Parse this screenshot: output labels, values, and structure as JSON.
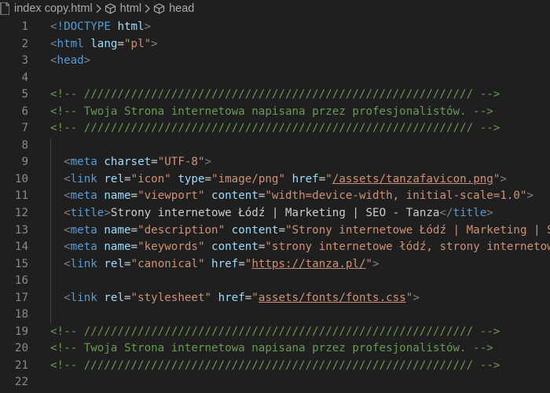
{
  "breadcrumb": {
    "file": "index copy.html",
    "symbol1": "html",
    "symbol2": "head"
  },
  "editor": {
    "lines": [
      {
        "n": "1",
        "tokens": [
          [
            "punc",
            "<"
          ],
          [
            "tag",
            "!DOCTYPE"
          ],
          [
            "text",
            " "
          ],
          [
            "attr",
            "html"
          ],
          [
            "punc",
            ">"
          ]
        ]
      },
      {
        "n": "2",
        "tokens": [
          [
            "punc",
            "<"
          ],
          [
            "tag",
            "html"
          ],
          [
            "text",
            " "
          ],
          [
            "attr",
            "lang"
          ],
          [
            "text",
            "="
          ],
          [
            "str",
            "\"pl\""
          ],
          [
            "punc",
            ">"
          ]
        ]
      },
      {
        "n": "3",
        "tokens": [
          [
            "punc",
            "<"
          ],
          [
            "tag",
            "head"
          ],
          [
            "punc",
            ">"
          ]
        ]
      },
      {
        "n": "4",
        "tokens": []
      },
      {
        "n": "5",
        "tokens": [
          [
            "com",
            "<!-- ////////////////////////////////////////////////////////// -->"
          ]
        ]
      },
      {
        "n": "6",
        "tokens": [
          [
            "com",
            "<!-- Twoja Strona internetowa napisana przez profesjonalistów. -->"
          ]
        ]
      },
      {
        "n": "7",
        "tokens": [
          [
            "com",
            "<!-- ////////////////////////////////////////////////////////// -->"
          ]
        ]
      },
      {
        "n": "8",
        "tokens": []
      },
      {
        "n": "9",
        "tokens": [
          [
            "text",
            "  "
          ],
          [
            "punc",
            "<"
          ],
          [
            "tag",
            "meta"
          ],
          [
            "text",
            " "
          ],
          [
            "attr",
            "charset"
          ],
          [
            "text",
            "="
          ],
          [
            "str",
            "\"UTF-8\""
          ],
          [
            "punc",
            ">"
          ]
        ]
      },
      {
        "n": "10",
        "tokens": [
          [
            "text",
            "  "
          ],
          [
            "punc",
            "<"
          ],
          [
            "tag",
            "link"
          ],
          [
            "text",
            " "
          ],
          [
            "attr",
            "rel"
          ],
          [
            "text",
            "="
          ],
          [
            "str",
            "\"icon\""
          ],
          [
            "text",
            " "
          ],
          [
            "attr",
            "type"
          ],
          [
            "text",
            "="
          ],
          [
            "str",
            "\"image/png\""
          ],
          [
            "text",
            " "
          ],
          [
            "attr",
            "href"
          ],
          [
            "text",
            "="
          ],
          [
            "str",
            "\""
          ],
          [
            "strlink",
            "/assets/tanzafavicon.png"
          ],
          [
            "str",
            "\""
          ],
          [
            "punc",
            ">"
          ]
        ]
      },
      {
        "n": "11",
        "tokens": [
          [
            "text",
            "  "
          ],
          [
            "punc",
            "<"
          ],
          [
            "tag",
            "meta"
          ],
          [
            "text",
            " "
          ],
          [
            "attr",
            "name"
          ],
          [
            "text",
            "="
          ],
          [
            "str",
            "\"viewport\""
          ],
          [
            "text",
            " "
          ],
          [
            "attr",
            "content"
          ],
          [
            "text",
            "="
          ],
          [
            "str",
            "\"width=device-width, initial-scale=1.0\""
          ],
          [
            "punc",
            ">"
          ]
        ]
      },
      {
        "n": "12",
        "tokens": [
          [
            "text",
            "  "
          ],
          [
            "punc",
            "<"
          ],
          [
            "tag",
            "title"
          ],
          [
            "punc",
            ">"
          ],
          [
            "text",
            "Strony internetowe Łódź | Marketing | SEO - Tanza"
          ],
          [
            "punc",
            "</"
          ],
          [
            "tag",
            "title"
          ],
          [
            "punc",
            ">"
          ]
        ]
      },
      {
        "n": "13",
        "tokens": [
          [
            "text",
            "  "
          ],
          [
            "punc",
            "<"
          ],
          [
            "tag",
            "meta"
          ],
          [
            "text",
            " "
          ],
          [
            "attr",
            "name"
          ],
          [
            "text",
            "="
          ],
          [
            "str",
            "\"description\""
          ],
          [
            "text",
            " "
          ],
          [
            "attr",
            "content"
          ],
          [
            "text",
            "="
          ],
          [
            "str",
            "\"Strony internetowe Łódź | Marketing | SEO - Tanza\""
          ],
          [
            "punc",
            ">"
          ]
        ]
      },
      {
        "n": "14",
        "tokens": [
          [
            "text",
            "  "
          ],
          [
            "punc",
            "<"
          ],
          [
            "tag",
            "meta"
          ],
          [
            "text",
            " "
          ],
          [
            "attr",
            "name"
          ],
          [
            "text",
            "="
          ],
          [
            "str",
            "\"keywords\""
          ],
          [
            "text",
            " "
          ],
          [
            "attr",
            "content"
          ],
          [
            "text",
            "="
          ],
          [
            "str",
            "\"strony internetowe łódź, strony internetowe\""
          ],
          [
            "punc",
            ">"
          ]
        ]
      },
      {
        "n": "15",
        "tokens": [
          [
            "text",
            "  "
          ],
          [
            "punc",
            "<"
          ],
          [
            "tag",
            "link"
          ],
          [
            "text",
            " "
          ],
          [
            "attr",
            "rel"
          ],
          [
            "text",
            "="
          ],
          [
            "str",
            "\"canonical\""
          ],
          [
            "text",
            " "
          ],
          [
            "attr",
            "href"
          ],
          [
            "text",
            "="
          ],
          [
            "str",
            "\""
          ],
          [
            "strlink",
            "https://tanza.pl/"
          ],
          [
            "str",
            "\""
          ],
          [
            "punc",
            ">"
          ]
        ]
      },
      {
        "n": "16",
        "tokens": []
      },
      {
        "n": "17",
        "tokens": [
          [
            "text",
            "  "
          ],
          [
            "punc",
            "<"
          ],
          [
            "tag",
            "link"
          ],
          [
            "text",
            " "
          ],
          [
            "attr",
            "rel"
          ],
          [
            "text",
            "="
          ],
          [
            "str",
            "\"stylesheet\""
          ],
          [
            "text",
            " "
          ],
          [
            "attr",
            "href"
          ],
          [
            "text",
            "="
          ],
          [
            "str",
            "\""
          ],
          [
            "strlink",
            "assets/fonts/fonts.css"
          ],
          [
            "str",
            "\""
          ],
          [
            "punc",
            ">"
          ]
        ]
      },
      {
        "n": "18",
        "tokens": []
      },
      {
        "n": "19",
        "tokens": [
          [
            "com",
            "<!-- ////////////////////////////////////////////////////////// -->"
          ]
        ]
      },
      {
        "n": "20",
        "tokens": [
          [
            "com",
            "<!-- Twoja Strona internetowa napisana przez profesjonalistów. -->"
          ]
        ]
      },
      {
        "n": "21",
        "tokens": [
          [
            "com",
            "<!-- ////////////////////////////////////////////////////////// -->"
          ]
        ]
      },
      {
        "n": "22",
        "tokens": []
      }
    ]
  },
  "colors": {
    "background": "#1f1f1f",
    "line_number": "#8a8a8a",
    "punctuation": "#808080",
    "tag": "#569cd6",
    "attribute": "#9cdcfe",
    "string": "#ce9178",
    "text": "#cccccc",
    "comment": "#6a9955"
  },
  "icons": {
    "file": "html-file-icon",
    "separator": "chevron-right-icon",
    "symbol": "symbol-element-icon"
  }
}
